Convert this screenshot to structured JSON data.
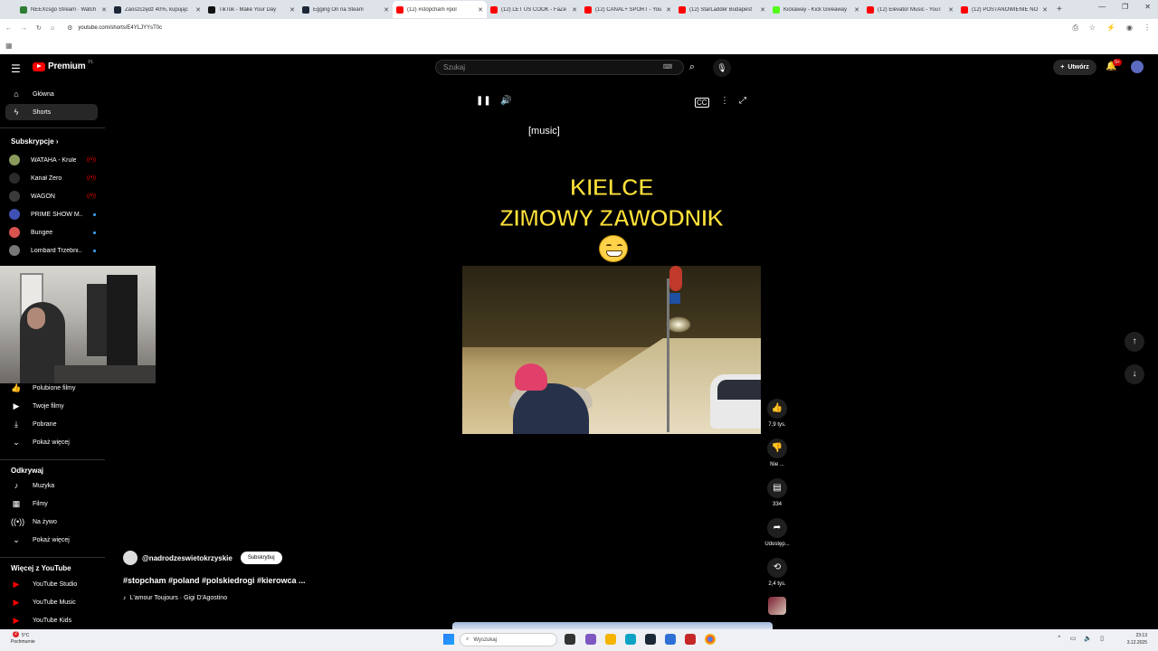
{
  "browser": {
    "tabs": [
      {
        "title": "NEEXcsgo Stream · Watch",
        "favicon_color": "#2e7d32"
      },
      {
        "title": "Zaoszczędź 40%, kupując",
        "favicon_color": "#1b2838"
      },
      {
        "title": "TikTok - Make Your Day",
        "favicon_color": "#111111"
      },
      {
        "title": "Egging On na Steam",
        "favicon_color": "#1b2838"
      },
      {
        "title": "(12) #stopcham #pol",
        "favicon_color": "#ff0000",
        "active": true
      },
      {
        "title": "(12) LET US COOK - FaZe",
        "favicon_color": "#ff0000"
      },
      {
        "title": "(12) CANAL+ SPORT - You",
        "favicon_color": "#ff0000"
      },
      {
        "title": "(12) StarLadder Budapest",
        "favicon_color": "#ff0000"
      },
      {
        "title": "Kickaway - Kick Giveaway",
        "favicon_color": "#53fc18"
      },
      {
        "title": "(12) Elevator Music - YouT",
        "favicon_color": "#ff0000"
      },
      {
        "title": "(12) POSTANOWIENIE NO",
        "favicon_color": "#ff0000"
      }
    ],
    "url": "youtube.com/shorts/E4YLJYYsT0c"
  },
  "header": {
    "logo_text": "Premium",
    "logo_region": "PL",
    "search_placeholder": "Szukaj",
    "create_label": "Utwórz",
    "notifications_badge": "9+"
  },
  "sidebar": {
    "main": [
      {
        "label": "Główna",
        "icon": "home-icon",
        "glyph": "⌂"
      },
      {
        "label": "Shorts",
        "icon": "shorts-icon",
        "glyph": "ϟ",
        "active": true
      }
    ],
    "subscriptions_title": "Subskrypcje",
    "subscriptions": [
      {
        "name": "WATAHA - Krule...",
        "color": "#8a9a5b",
        "indicator": "live"
      },
      {
        "name": "Kanał Zero",
        "color": "#2b2b2b",
        "indicator": "live"
      },
      {
        "name": "WAGON",
        "color": "#3a3a3a",
        "indicator": "live"
      },
      {
        "name": "PRIME SHOW M...",
        "color": "#3f51b5",
        "indicator": "new"
      },
      {
        "name": "Bungee",
        "color": "#d9534f",
        "indicator": "new"
      },
      {
        "name": "Lombard Trzebni...",
        "color": "#777777",
        "indicator": "new"
      }
    ],
    "you_items": [
      {
        "label": "Polubione filmy",
        "glyph": "👍",
        "icon": "liked-icon"
      },
      {
        "label": "Twoje filmy",
        "glyph": "▶",
        "icon": "your-videos-icon"
      },
      {
        "label": "Pobrane",
        "glyph": "⤓",
        "icon": "download-icon"
      },
      {
        "label": "Pokaż więcej",
        "glyph": "⌄",
        "icon": "chevron-down-icon"
      }
    ],
    "explore_title": "Odkrywaj",
    "explore_items": [
      {
        "label": "Muzyka",
        "glyph": "♪",
        "icon": "music-icon"
      },
      {
        "label": "Filmy",
        "glyph": "▦",
        "icon": "film-icon"
      },
      {
        "label": "Na żywo",
        "glyph": "((•))",
        "icon": "live-icon"
      },
      {
        "label": "Pokaż więcej",
        "glyph": "⌄",
        "icon": "chevron-down-icon"
      }
    ],
    "more_title": "Więcej z YouTube",
    "more_items": [
      {
        "label": "YouTube Studio",
        "icon": "youtube-studio-icon"
      },
      {
        "label": "YouTube Music",
        "icon": "youtube-music-icon"
      },
      {
        "label": "YouTube Kids",
        "icon": "youtube-kids-icon"
      }
    ]
  },
  "player": {
    "caption": "[music]",
    "headline_line1": "KIELCE",
    "headline_line2": "ZIMOWY ZAWODNIK"
  },
  "actions": {
    "likes": "7,9 tys.",
    "dislike": "Nie ...",
    "comments": "334",
    "share": "Udostęp...",
    "remix": "2,4 tys."
  },
  "video": {
    "channel": "@nadrodzeswietokrzyskie",
    "subscribe_label": "Subskrybuj",
    "title": "#stopcham #poland #polskiedrogi #kierowca ...",
    "music": "L'amour Toujours · Gigi D'Agostino"
  },
  "taskbar": {
    "weather_temp": "5°C",
    "weather_desc": "Pochmurnie",
    "weather_badge": "2",
    "search_placeholder": "Wyszukaj",
    "time": "23:13",
    "date": "3.12.2025"
  }
}
